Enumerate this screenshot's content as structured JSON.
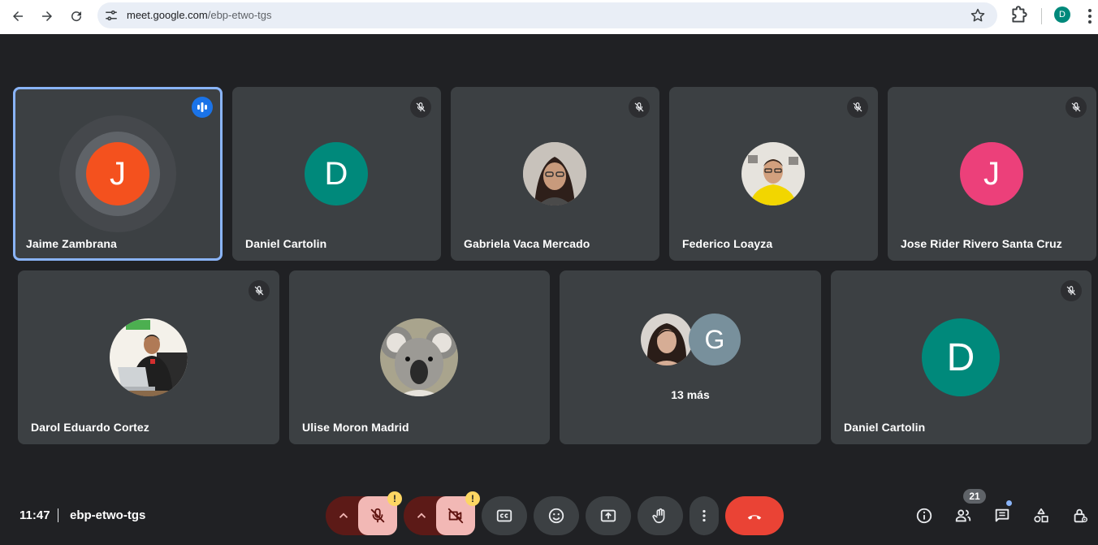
{
  "browser": {
    "url_host": "meet.google.com",
    "url_path": "/ebp-etwo-tgs",
    "profile_initial": "D",
    "profile_color": "#00897b"
  },
  "tiles": [
    {
      "name": "Jaime Zambrana",
      "initial": "J",
      "color": "#f4511e",
      "status": "speaking"
    },
    {
      "name": "Daniel Cartolin",
      "initial": "D",
      "color": "#00897b",
      "status": "muted"
    },
    {
      "name": "Gabriela Vaca Mercado",
      "status": "muted"
    },
    {
      "name": "Federico Loayza",
      "status": "muted"
    },
    {
      "name": "Jose Rider Rivero Santa Cruz",
      "initial": "J",
      "color": "#ec407a",
      "status": "muted"
    },
    {
      "name": "Darol Eduardo Cortez",
      "status": "muted"
    },
    {
      "name": "Ulise Moron Madrid"
    },
    {
      "overflow_initial": "G",
      "overflow_color": "#78909c",
      "more_label": "13 más"
    },
    {
      "name": "Daniel Cartolin",
      "initial": "D",
      "color": "#00897b",
      "status": "muted"
    }
  ],
  "bottom_bar": {
    "time": "11:47",
    "meeting_code": "ebp-etwo-tgs",
    "warn_mark": "!",
    "participants_count": "21"
  },
  "colors": {
    "background": "#202124",
    "tile": "#3c4043",
    "active_outline": "#8ab4f8",
    "hangup": "#ea4335",
    "device_off": "#5c1a17",
    "device_off_main": "#f2b8b5"
  },
  "icons": [
    "back-icon",
    "forward-icon",
    "reload-icon",
    "tune-icon",
    "star-icon",
    "extensions-icon",
    "more-vert-icon",
    "mic-off-icon",
    "speaking-icon",
    "chevron-up-icon",
    "videocam-off-icon",
    "captions-icon",
    "emoji-icon",
    "present-icon",
    "hand-icon",
    "call-end-icon",
    "info-icon",
    "people-icon",
    "chat-icon",
    "activities-icon",
    "host-controls-icon"
  ]
}
